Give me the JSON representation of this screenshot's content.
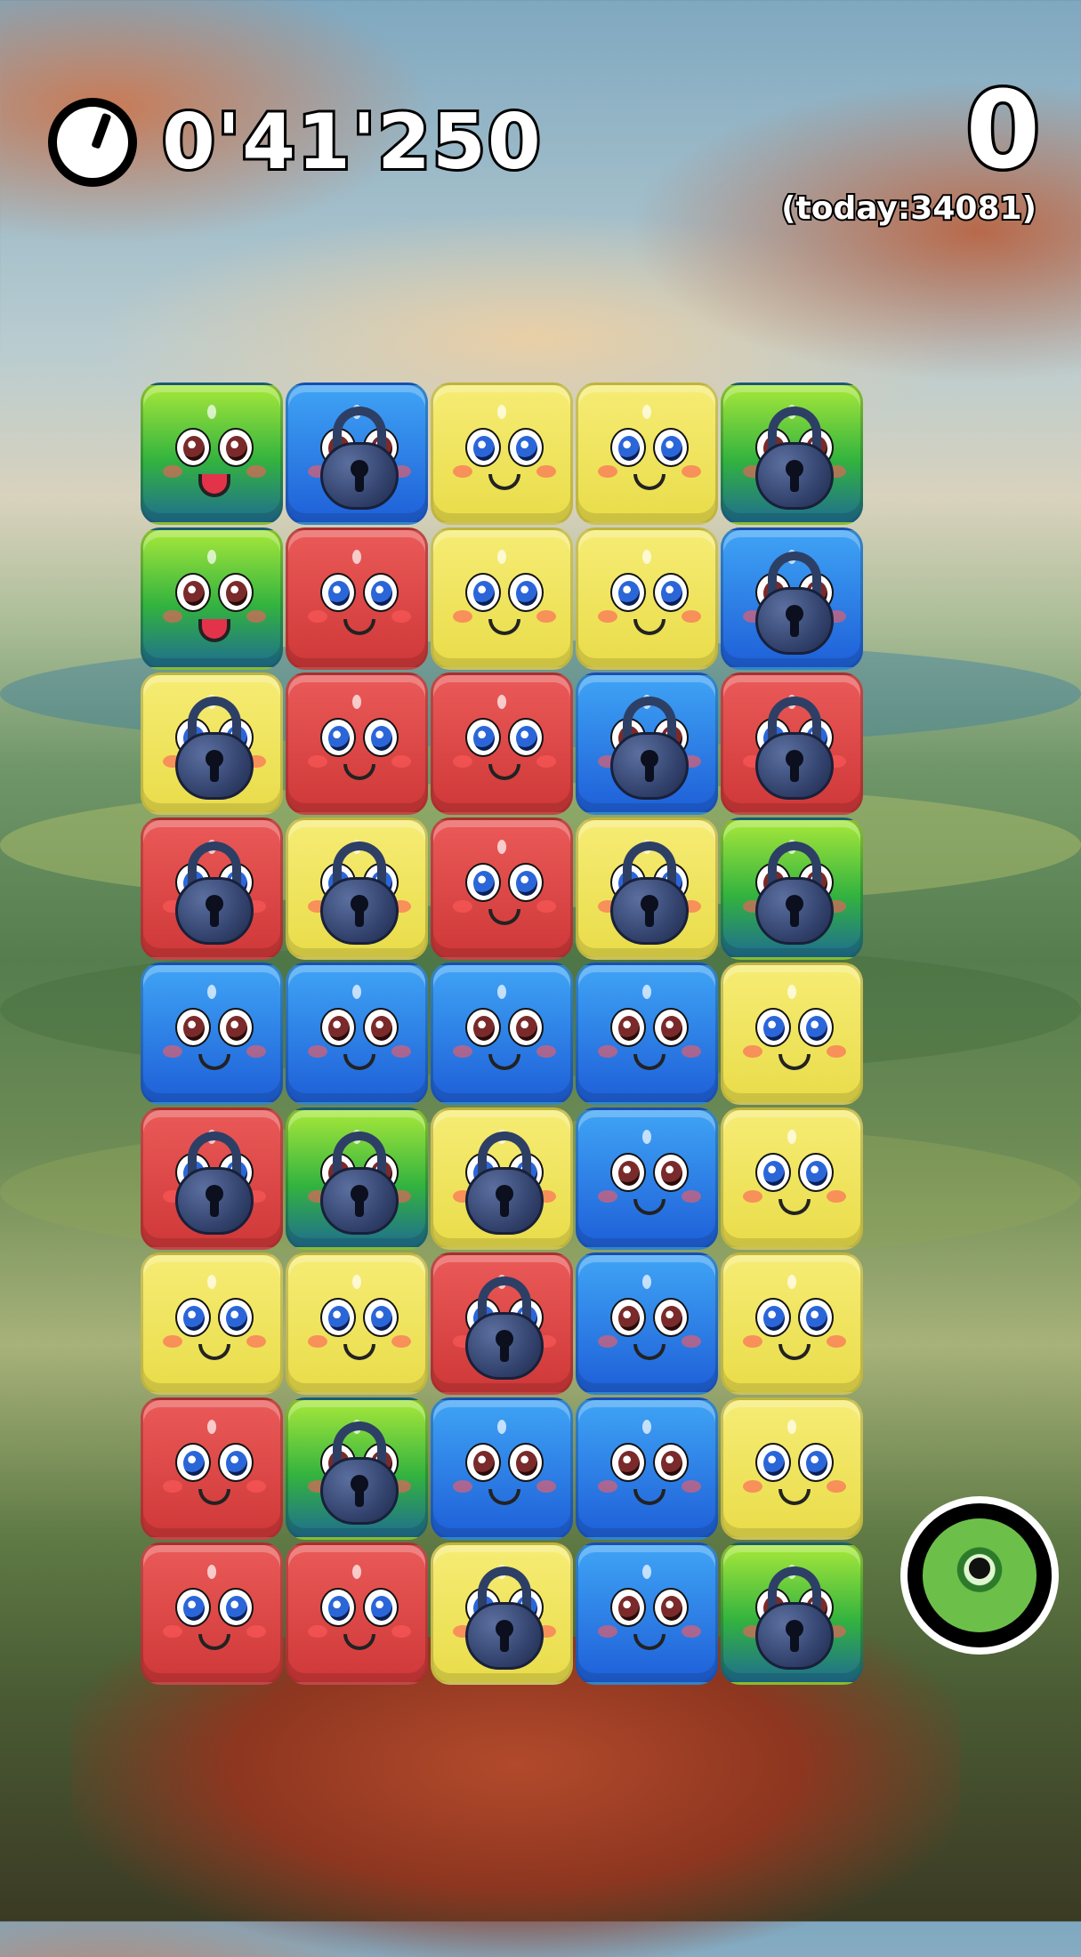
{
  "hud": {
    "timer": "0'41'250",
    "score": "0",
    "today": "(today:34081)"
  },
  "colors": {
    "yellow": "#f6ec74",
    "red": "#e04848",
    "blue": "#2f86ec",
    "green": "#4bbd3b",
    "lock": "#33436e"
  },
  "board": {
    "columns": 5,
    "rows": 9,
    "tiles": [
      [
        "green",
        "blue-locked",
        "yellow",
        "yellow",
        "green-locked"
      ],
      [
        "green",
        "red",
        "yellow",
        "yellow",
        "blue-locked"
      ],
      [
        "yellow-locked",
        "red",
        "red",
        "blue-locked",
        "red-locked"
      ],
      [
        "red-locked",
        "yellow-locked",
        "red",
        "yellow-locked",
        "green-locked"
      ],
      [
        "blue",
        "blue",
        "blue",
        "blue",
        "yellow"
      ],
      [
        "red-locked",
        "green-locked",
        "yellow-locked",
        "blue",
        "yellow"
      ],
      [
        "yellow",
        "yellow",
        "red-locked",
        "blue",
        "yellow"
      ],
      [
        "red",
        "green-locked",
        "blue",
        "blue",
        "yellow"
      ],
      [
        "red",
        "red",
        "yellow-locked",
        "blue",
        "green-locked"
      ]
    ]
  },
  "icons": {
    "timer": "stopwatch-icon",
    "lock": "padlock-icon",
    "avatar": "monster-eye-icon"
  }
}
